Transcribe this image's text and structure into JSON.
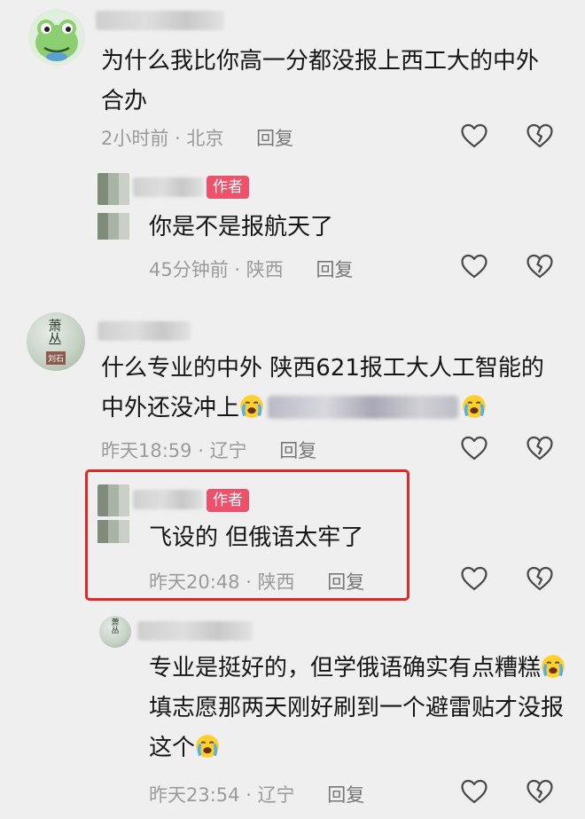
{
  "author_badge": "作者",
  "reply_label": "回复",
  "icons": {
    "like": "heart-outline-icon",
    "dislike": "broken-heart-icon"
  },
  "avatar_text": {
    "c3_top": "萧丛",
    "c3_bottom": "刘石"
  },
  "comments": [
    {
      "text": "为什么我比你高一分都没报上西工大的中外合办",
      "time": "2小时前",
      "location": "北京"
    },
    {
      "text": "你是不是报航天了",
      "time": "45分钟前",
      "location": "陕西",
      "is_author": true
    },
    {
      "text_part1": "什么专业的中外 陕西621报工大人工智能的中外还没冲上",
      "time": "昨天18:59",
      "location": "辽宁"
    },
    {
      "text": "飞设的 但俄语太牢了",
      "time": "昨天20:48",
      "location": "陕西",
      "is_author": true
    },
    {
      "text_part1": "专业是挺好的，但学俄语确实有点糟糕",
      "text_part2": "填志愿那两天刚好刷到一个避雷贴才没报这个",
      "time": "昨天23:54",
      "location": "辽宁"
    }
  ],
  "colors": {
    "author_badge": "#f0506a",
    "highlight_border": "#e32626"
  }
}
